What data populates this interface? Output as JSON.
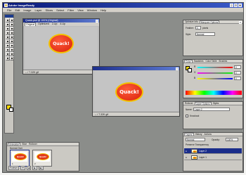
{
  "app": {
    "title": "Adobe ImageReady",
    "window_buttons": [
      "_",
      "□",
      "×"
    ]
  },
  "menu": [
    "File",
    "Edit",
    "Image",
    "Layer",
    "Slices",
    "Select",
    "Filter",
    "View",
    "Window",
    "Help"
  ],
  "doc1": {
    "title": "Quack.psd @ 100% (Original)",
    "tabs": [
      "Original",
      "Optimized",
      "2-Up",
      "4-Up"
    ],
    "status": "-- / 7.32K gif",
    "quack_text": "Quack!"
  },
  "doc2": {
    "status": "-- / 7.32K gif",
    "quack_text": "Quack!"
  },
  "optimize_palette": {
    "tabs": [
      "Optimize Info",
      "Marquee Options"
    ],
    "feather_label": "Feather:",
    "feather_value": "0",
    "unit": "pixels",
    "style_label": "Style:",
    "style_value": "Normal"
  },
  "color_palette": {
    "tabs": [
      "Color",
      "Swatches",
      "Color Table",
      "Brushes"
    ],
    "channels": [
      "R",
      "G",
      "B"
    ],
    "values": [
      "0",
      "0",
      "0"
    ]
  },
  "layer_options_palette": {
    "tabs": [
      "Rollover",
      "Layer Options",
      "Styles"
    ],
    "name_label": "Name:",
    "name_value": "Layer 2",
    "checkbox_label": "Knockout"
  },
  "layers_palette": {
    "tabs": [
      "Layers",
      "History",
      "Actions"
    ],
    "blend_mode": "Normal",
    "opacity_label": "Opacity:",
    "opacity_value": "100%",
    "preserve_label": "Preserve Transparency",
    "layers": [
      {
        "name": "Layer 2",
        "selected": true
      },
      {
        "name": "Layer 1",
        "selected": false
      }
    ]
  },
  "animation_palette": {
    "tabs": [
      "Animation",
      "Slice",
      "Rollover"
    ],
    "frames": [
      {
        "label": "1",
        "quack_text": "Quack!"
      },
      {
        "label": "2",
        "quack_text": "Quack!"
      }
    ],
    "frame_text": "Normal   Over",
    "loop_label": "Forever",
    "controls": [
      "⏮",
      "◀",
      "▶",
      "▶|"
    ]
  }
}
